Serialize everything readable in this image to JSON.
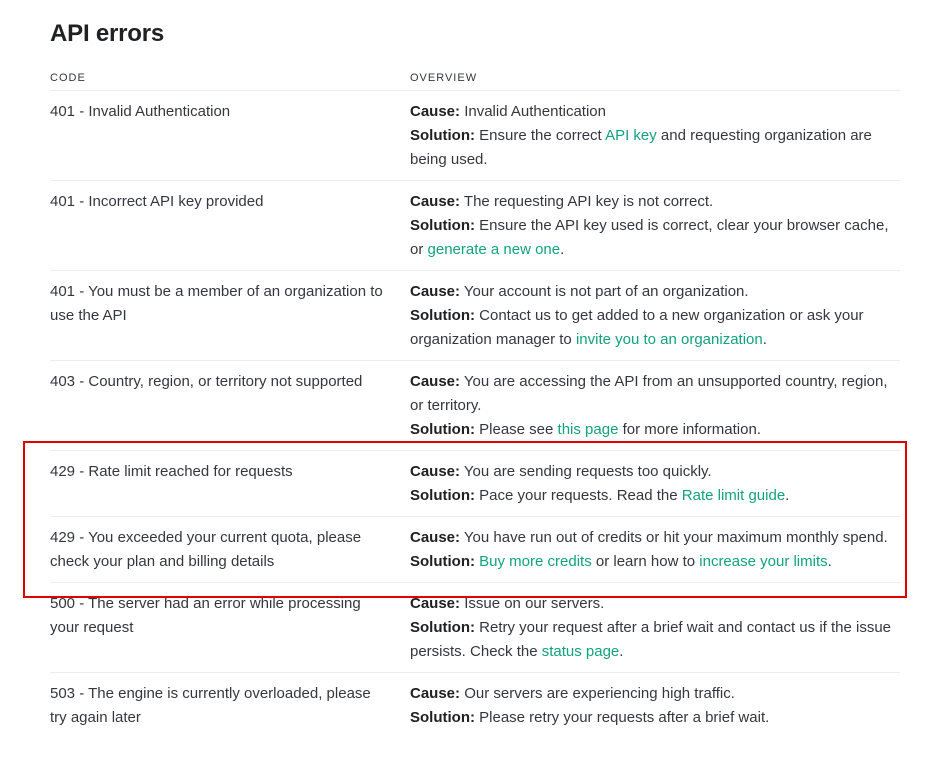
{
  "title": "API errors",
  "headers": {
    "code": "CODE",
    "overview": "OVERVIEW"
  },
  "labels": {
    "cause": "Cause:",
    "solution": "Solution:"
  },
  "rows": [
    {
      "code": "401 - Invalid Authentication",
      "cause": " Invalid Authentication",
      "sol_a": " Ensure the correct ",
      "link1": "API key",
      "sol_b": " and requesting organization are being used.",
      "link2": "",
      "sol_c": ""
    },
    {
      "code": "401 - Incorrect API key provided",
      "cause": " The requesting API key is not correct.",
      "sol_a": " Ensure the API key used is correct, clear your browser cache, or ",
      "link1": "generate a new one",
      "sol_b": ".",
      "link2": "",
      "sol_c": ""
    },
    {
      "code": "401 - You must be a member of an organization to use the API",
      "cause": " Your account is not part of an organization.",
      "sol_a": " Contact us to get added to a new organization or ask your organization manager to ",
      "link1": "invite you to an organization",
      "sol_b": ".",
      "link2": "",
      "sol_c": ""
    },
    {
      "code": "403 - Country, region, or territory not supported",
      "cause": " You are accessing the API from an unsupported country, region, or territory.",
      "sol_a": " Please see ",
      "link1": "this page",
      "sol_b": " for more information.",
      "link2": "",
      "sol_c": ""
    },
    {
      "code": "429 - Rate limit reached for requests",
      "cause": " You are sending requests too quickly.",
      "sol_a": " Pace your requests. Read the ",
      "link1": "Rate limit guide",
      "sol_b": ".",
      "link2": "",
      "sol_c": ""
    },
    {
      "code": "429 - You exceeded your current quota, please check your plan and billing details",
      "cause": " You have run out of credits or hit your maximum monthly spend.",
      "sol_a": " ",
      "link1": "Buy more credits",
      "sol_b": " or learn how to ",
      "link2": "increase your limits",
      "sol_c": "."
    },
    {
      "code": "500 - The server had an error while processing your request",
      "cause": " Issue on our servers.",
      "sol_a": " Retry your request after a brief wait and contact us if the issue persists. Check the ",
      "link1": "status page",
      "sol_b": ".",
      "link2": "",
      "sol_c": ""
    },
    {
      "code": "503 - The engine is currently overloaded, please try again later",
      "cause": " Our servers are experiencing high traffic.",
      "sol_a": " Please retry your requests after a brief wait.",
      "link1": "",
      "sol_b": "",
      "link2": "",
      "sol_c": ""
    }
  ],
  "colors": {
    "link": "#10a37f",
    "highlight": "#e00000",
    "divider": "#ececf1"
  }
}
